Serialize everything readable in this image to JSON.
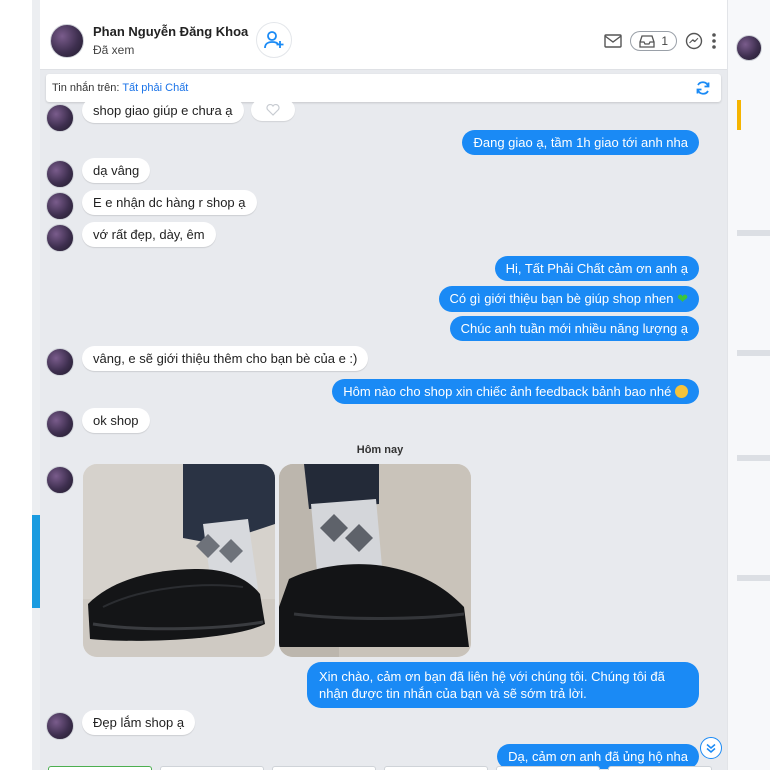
{
  "header": {
    "name": "Phan Nguyễn Đăng Khoa",
    "status": "Đã xem",
    "inbox_count": "1"
  },
  "topbar": {
    "label": "Tin nhắn trên: ",
    "page": "Tất phải Chất"
  },
  "messages": {
    "m0": "shop giao giúp e chưa ạ",
    "m1": "Đang giao ạ, tầm 1h giao tới anh nha",
    "m2": "dạ vâng",
    "m3": "E e nhận dc hàng r shop ạ",
    "m4": "vớ rất đẹp, dày, êm",
    "m5": "Hi, Tất Phải Chất cảm ơn anh ạ",
    "m6": "Có gì giới thiệu bạn bè giúp shop nhen",
    "m7": "Chúc anh tuần mới nhiều năng lượng ạ",
    "m8": "vâng, e sẽ giới thiệu thêm cho bạn bè của e :)",
    "m9": "Hôm nào cho shop xin chiếc ảnh feedback bảnh bao nhé",
    "m10": "ok shop",
    "date_sep": "Hôm nay",
    "m11": "Xin chào, cảm ơn bạn đã liên hệ với chúng tôi. Chúng tôi đã nhận được tin nhắn của bạn và sẽ sớm trả lời.",
    "m12": "Đẹp lắm shop ạ",
    "m13": "Dạ, cảm ơn anh đã ủng hộ nha"
  },
  "colors": {
    "outgoing_bubble": "#1a8af5",
    "incoming_bubble": "#ffffff",
    "chat_bg": "#e8eaee"
  },
  "icons": [
    "user-add-icon",
    "mail-icon",
    "inbox-icon",
    "messenger-icon",
    "more-icon",
    "sync-icon",
    "heart-icon",
    "green-heart-emoji",
    "smile-emoji",
    "scroll-down-icon"
  ]
}
